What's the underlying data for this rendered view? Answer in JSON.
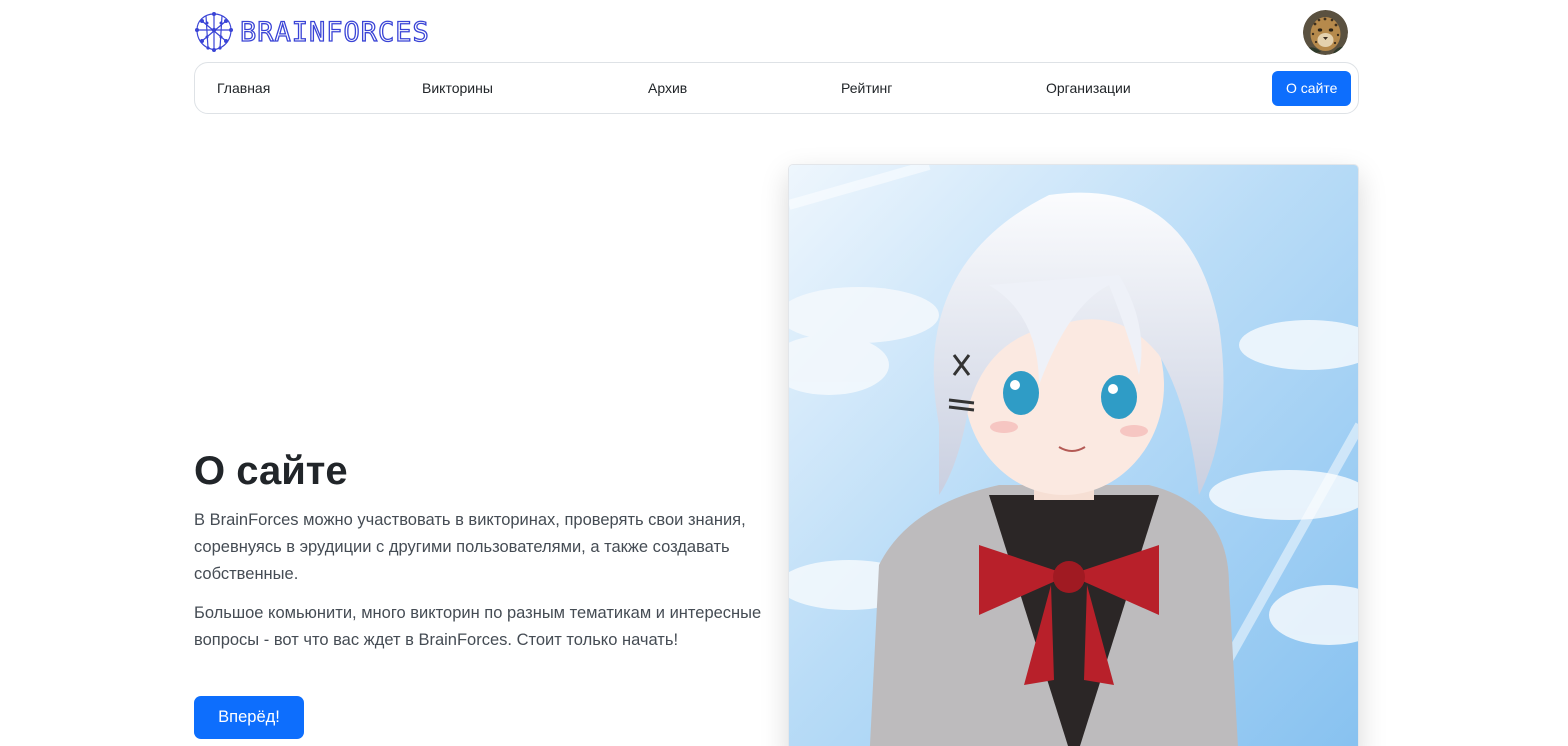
{
  "header": {
    "logo_text": "BRAINFORCES",
    "logo_icon": "brain-network-icon",
    "avatar_icon": "leopard-avatar",
    "logo_color": "#3a44d6"
  },
  "nav": {
    "items": [
      {
        "label": "Главная"
      },
      {
        "label": "Викторины"
      },
      {
        "label": "Архив"
      },
      {
        "label": "Рейтинг"
      },
      {
        "label": "Организации"
      },
      {
        "label": "О сайте",
        "active": true
      }
    ],
    "active_color": "#0d6efd"
  },
  "hero": {
    "title": "О сайте",
    "paragraph1": "В BrainForces можно участвовать в викторинах, проверять свои знания, соревнуясь в эрудиции с другими пользователями, а также создавать собственные.",
    "paragraph2": "Большое комьюнити, много викторин по разным тематикам и интересные вопросы - вот что вас ждет в BrainForces. Стоит только начать!",
    "button_label": "Вперёд!",
    "image": "anime-girl-illustration"
  }
}
